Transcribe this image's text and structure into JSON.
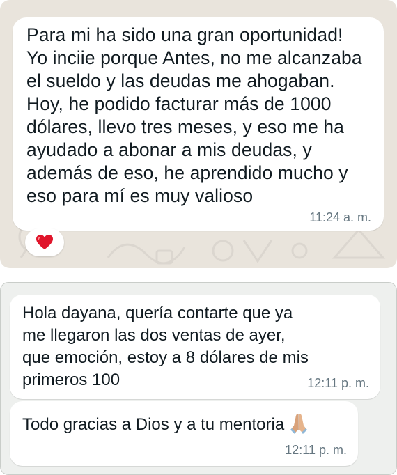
{
  "top_chat": {
    "message": {
      "lines": [
        "Para mi ha sido una gran oportunidad!",
        "Yo inciie porque Antes, no me alcanzaba",
        "el sueldo y las deudas me ahogaban.",
        "Hoy, he podido facturar más de 1000",
        "dólares, llevo tres meses, y eso me ha",
        "ayudado a abonar a mis  deudas, y",
        "además de eso, he aprendido mucho y",
        "eso para mí es muy valioso"
      ],
      "time": "11:24 a. m.",
      "reaction_icon": "red-heart-icon"
    },
    "background_color": "#e9e4dc"
  },
  "bottom_chat": {
    "messages": [
      {
        "lines": [
          "Hola dayana, quería contarte que ya",
          "me llegaron las dos ventas de ayer,",
          "que emoción, estoy a 8 dólares de mis",
          "primeros 100"
        ],
        "time": "12:11 p. m."
      },
      {
        "text": "Todo gracias a Dios y a tu mentoria",
        "emoji_icon": "folded-hands-icon",
        "time": "12:11 p. m."
      }
    ],
    "background_color": "#eef0ee"
  }
}
